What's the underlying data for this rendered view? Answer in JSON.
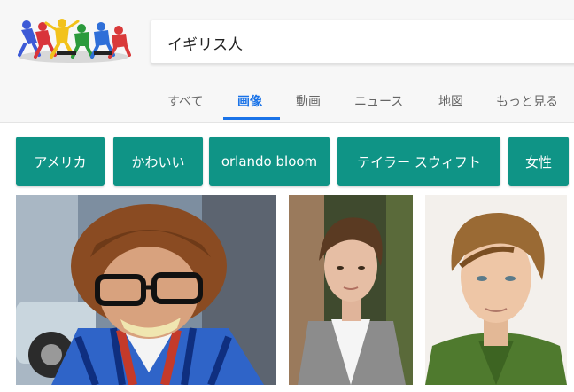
{
  "search": {
    "query": "イギリス人"
  },
  "tabs": [
    {
      "label": "すべて"
    },
    {
      "label": "画像",
      "active": true
    },
    {
      "label": "動画"
    },
    {
      "label": "ニュース"
    },
    {
      "label": "地図"
    },
    {
      "label": "もっと見る"
    }
  ],
  "related_chips": [
    {
      "label": "アメリカ"
    },
    {
      "label": "かわいい"
    },
    {
      "label": "orlando bloom"
    },
    {
      "label": "テイラー スウィフト"
    },
    {
      "label": "女性"
    }
  ],
  "colors": {
    "accent": "#1a73e8",
    "chip": "#0f9486",
    "header_bg": "#f7f7f7"
  },
  "results": [
    {
      "name": "image-result-1"
    },
    {
      "name": "image-result-2"
    },
    {
      "name": "image-result-3"
    }
  ]
}
